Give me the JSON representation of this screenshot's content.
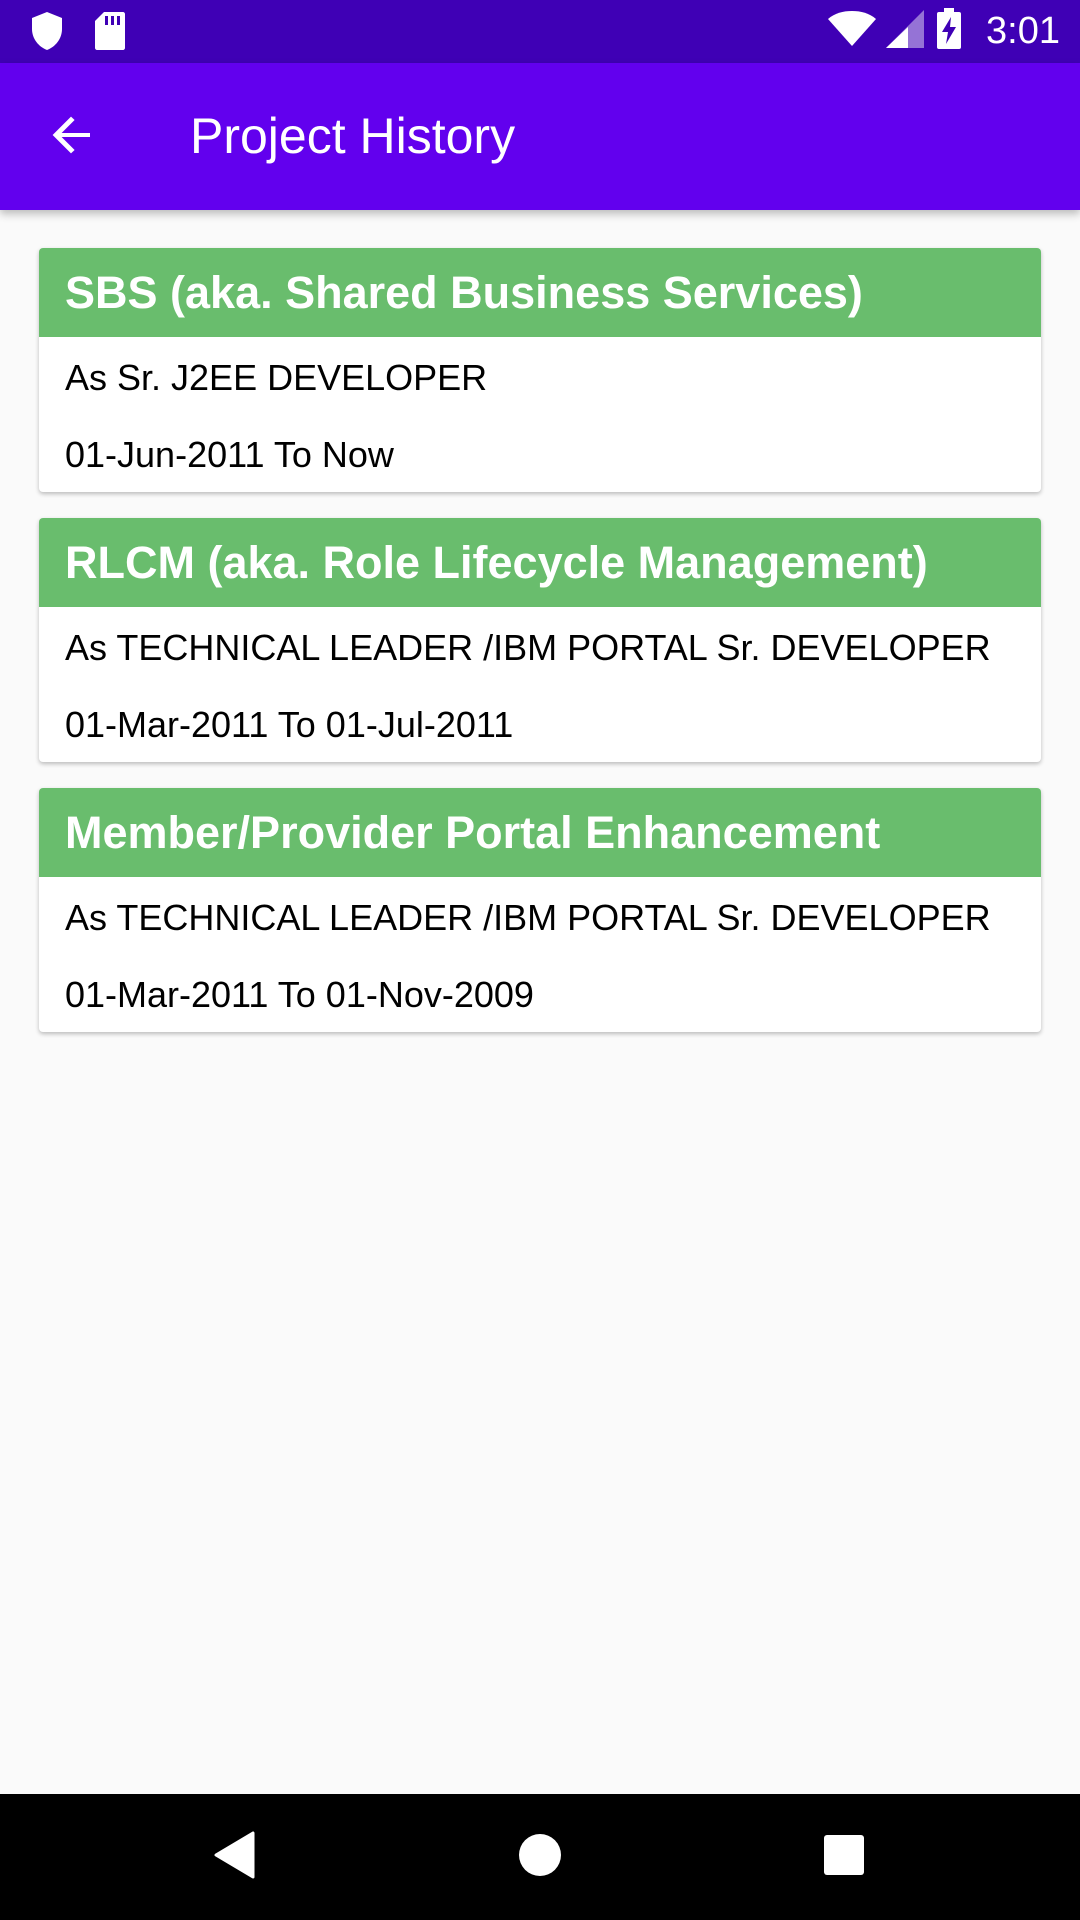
{
  "status_bar": {
    "time": "3:01",
    "icons": [
      "shield-icon",
      "sd-card-icon",
      "wifi-icon",
      "signal-icon",
      "battery-charging-icon"
    ]
  },
  "app_bar": {
    "title": "Project History",
    "back_icon": "arrow-back-icon"
  },
  "projects": [
    {
      "title": "SBS (aka. Shared Business Services)",
      "role": "As Sr. J2EE DEVELOPER",
      "period": "01-Jun-2011 To Now"
    },
    {
      "title": "RLCM (aka. Role Lifecycle Management)",
      "role": "As TECHNICAL LEADER /IBM PORTAL Sr. DEVELOPER",
      "period": "01-Mar-2011 To 01-Jul-2011"
    },
    {
      "title": "Member/Provider Portal Enhancement",
      "role": "As TECHNICAL LEADER /IBM PORTAL Sr. DEVELOPER",
      "period": "01-Mar-2011 To 01-Nov-2009"
    }
  ],
  "nav_bar": {
    "icons": [
      "back-triangle-icon",
      "home-circle-icon",
      "recents-square-icon"
    ]
  },
  "colors": {
    "status_bar": "#3f00b5",
    "app_bar": "#6200ee",
    "card_header": "#69bd6d",
    "background": "#fafafa"
  }
}
